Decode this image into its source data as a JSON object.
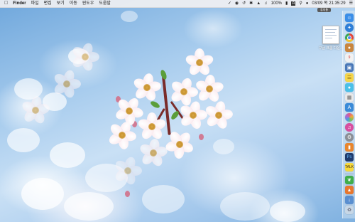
{
  "menubar": {
    "apple_icon": "apple-icon",
    "app_name": "Finder",
    "menus": [
      "파일",
      "편집",
      "보기",
      "이동",
      "윈도우",
      "도움말"
    ],
    "status": {
      "battery": "100%",
      "input_source": "A",
      "datetime": "03/09 목 21:35:29"
    }
  },
  "tooltip": {
    "label": "휴지통"
  },
  "desktop": {
    "file_label": "구글 크롬 다운..."
  },
  "dock": {
    "items": [
      {
        "name": "finder-icon",
        "color": "#3b8ee8"
      },
      {
        "name": "safari-icon",
        "color": "#2f7fd8"
      },
      {
        "name": "chrome-icon",
        "color": "#e3453b"
      },
      {
        "name": "contacts-icon",
        "color": "#c9863f"
      },
      {
        "name": "calendar-icon",
        "color": "#f1f1f1"
      },
      {
        "name": "photos-icon",
        "color": "#4a78b8"
      },
      {
        "name": "notes-icon",
        "color": "#f5d54a"
      },
      {
        "name": "messages-icon",
        "color": "#4bc0e8"
      },
      {
        "name": "preview-icon",
        "color": "#e8e8e8"
      },
      {
        "name": "app-store-icon",
        "color": "#3a8bd8"
      },
      {
        "name": "photo-app-icon",
        "color": "#e05a8a"
      },
      {
        "name": "itunes-icon",
        "color": "#d84ea0"
      },
      {
        "name": "system-preferences-icon",
        "color": "#8b8f96"
      },
      {
        "name": "ibooks-icon",
        "color": "#e8862e"
      },
      {
        "name": "photoshop-icon",
        "color": "#1f3b6e"
      },
      {
        "name": "kakaotalk-icon",
        "color": "#f7d83b"
      },
      {
        "name": "evernote-icon",
        "color": "#3fae4b"
      },
      {
        "name": "vlc-icon",
        "color": "#e8772e"
      },
      {
        "name": "downloads-icon",
        "color": "#5a8fd0"
      },
      {
        "name": "maps-icon",
        "color": "#6fbf5a"
      },
      {
        "name": "trash-icon",
        "color": "#c7d7e6"
      }
    ]
  }
}
